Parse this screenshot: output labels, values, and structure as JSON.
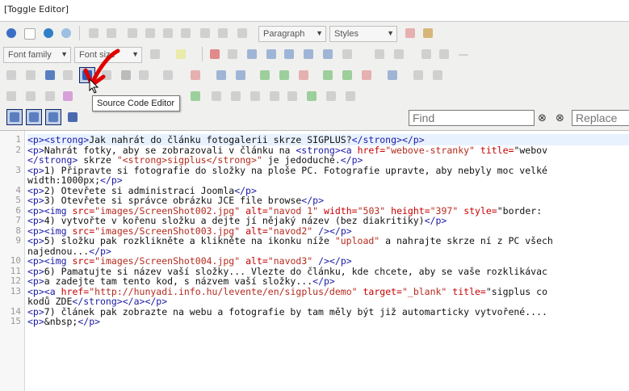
{
  "toggle_editor": "[Toggle Editor]",
  "toolbar": {
    "format_select": "Paragraph",
    "styles_select": "Styles",
    "font_family_select": "Font family",
    "font_size_select": "Font size"
  },
  "tooltip": "Source Code Editor",
  "search": {
    "find_placeholder": "Find",
    "replace_placeholder": "Replace"
  },
  "code": {
    "line_numbers": [
      "1",
      "2",
      "",
      "3",
      "",
      "4",
      "5",
      "6",
      "7",
      "8",
      "9",
      "",
      "10",
      "11",
      "12",
      "13",
      "",
      "14",
      "15"
    ],
    "lines": [
      "<p><strong>Jak nahrát do článku fotogalerii skrze SIGPLUS?</strong></p>",
      "<p>Nahrát fotky, aby se zobrazovali v článku na <strong><a href=\"webove-stranky\" title=\"webov",
      "</strong> skrze \"<strong>sigplus</strong>\" je jedoduché.</p>",
      "<p>1) Připravte si fotografie do složky na ploše PC. Fotografie upravte, aby nebyly moc velké",
      "width:1000px;</p>",
      "<p>2) Otevřete si administraci Joomla</p>",
      "<p>3) Otevřete si správce obrázku JCE file browse</p>",
      "<p><img src=\"images/ScreenShot002.jpg\" alt=\"navod 1\" width=\"503\" height=\"397\" style=\"border: ",
      "<p>4) vytvořte v kořenu složku a dejte jí nějaký název (bez diakritiky)</p>",
      "<p><img src=\"images/ScreenShot003.jpg\" alt=\"navod2\" /></p>",
      "<p>5) složku pak rozklikněte a klikněte na ikonku níže \"upload\" a nahrajte skrze ní z PC všech",
      "najednou...</p>",
      "<p><img src=\"images/ScreenShot004.jpg\" alt=\"navod3\" /></p>",
      "<p>6) Pamatujte si název vaší složky... Vlezte do článku, kde chcete, aby se vaše rozklikávac",
      "<p>a zadejte tam tento kod, s názvem vaší složky...</p>",
      "<p><a href=\"http://hunyadi.info.hu/levente/en/sigplus/demo\" target=\"_blank\" title=\"sigplus co",
      "kodů ZDE</strong></a></p>",
      "<p>7) článek pak zobrazte na webu a fotografie by tam měly být již automarticky vytvořené....",
      "<p>&nbsp;</p>"
    ]
  },
  "colors": {
    "tag": "#1a1aa6",
    "attr": "#c80000",
    "annotation": "#e00000"
  }
}
